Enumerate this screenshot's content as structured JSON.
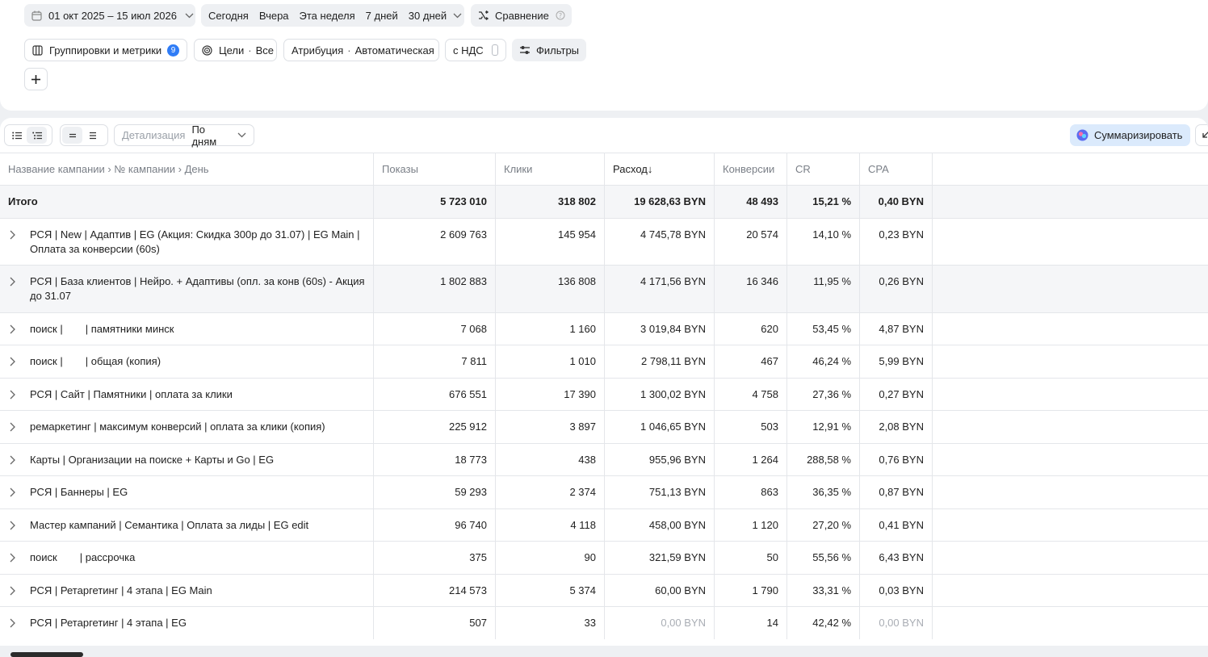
{
  "topbar": {
    "date_range": "01 окт 2025 – 15 июл 2026",
    "quick_ranges": [
      "Сегодня",
      "Вчера",
      "Эта неделя",
      "7 дней",
      "30 дней"
    ],
    "compare_label": "Сравнение",
    "groupings_label": "Группировки и метрики",
    "groupings_count": "9",
    "goals_label": "Цели",
    "goals_value": "Все",
    "attribution_label": "Атрибуция",
    "attribution_value": "Автоматическая",
    "vat_label": "с НДС",
    "filters_label": "Фильтры"
  },
  "toolbar": {
    "detail_label": "Детализация",
    "detail_value": "По дням",
    "summarize_label": "Суммаризировать"
  },
  "colors": {
    "accent": "#2f7cf6",
    "summarize_bg": "#dbeafc"
  },
  "table": {
    "headers": {
      "name": "Название кампании › № кампании › День",
      "shows": "Показы",
      "clicks": "Клики",
      "cost": "Расход",
      "conversions": "Конверсии",
      "cr": "CR",
      "cpa": "CPA"
    },
    "total": {
      "name": "Итого",
      "shows": "5 723 010",
      "clicks": "318 802",
      "cost": "19 628,63 BYN",
      "conversions": "48 493",
      "cr": "15,21 %",
      "cpa": "0,40 BYN"
    },
    "rows": [
      {
        "name": "РСЯ | New | Адаптив | EG (Акция: Скидка 300р до 31.07) | EG Main | Оплата за конверсии (60s)",
        "shows": "2 609 763",
        "clicks": "145 954",
        "cost": "4 745,78 BYN",
        "conversions": "20 574",
        "cr": "14,10 %",
        "cpa": "0,23 BYN"
      },
      {
        "name": "РСЯ | База клиентов | Нейро. + Адаптивы (опл. за конв (60s) - Акция до 31.07",
        "shows": "1 802 883",
        "clicks": "136 808",
        "cost": "4 171,56 BYN",
        "conversions": "16 346",
        "cr": "11,95 %",
        "cpa": "0,26 BYN"
      },
      {
        "name_a": "поиск |",
        "name_b": "| памятники минск",
        "shows": "7 068",
        "clicks": "1 160",
        "cost": "3 019,84 BYN",
        "conversions": "620",
        "cr": "53,45 %",
        "cpa": "4,87 BYN"
      },
      {
        "name_a": "поиск |",
        "name_b": "| общая (копия)",
        "shows": "7 811",
        "clicks": "1 010",
        "cost": "2 798,11 BYN",
        "conversions": "467",
        "cr": "46,24 %",
        "cpa": "5,99 BYN"
      },
      {
        "name": "РСЯ | Сайт | Памятники | оплата за клики",
        "shows": "676 551",
        "clicks": "17 390",
        "cost": "1 300,02 BYN",
        "conversions": "4 758",
        "cr": "27,36 %",
        "cpa": "0,27 BYN"
      },
      {
        "name": "ремаркетинг | максимум конверсий | оплата за клики (копия)",
        "shows": "225 912",
        "clicks": "3 897",
        "cost": "1 046,65 BYN",
        "conversions": "503",
        "cr": "12,91 %",
        "cpa": "2,08 BYN"
      },
      {
        "name": "Карты | Организации на поиске + Карты и Go | EG",
        "shows": "18 773",
        "clicks": "438",
        "cost": "955,96 BYN",
        "conversions": "1 264",
        "cr": "288,58 %",
        "cpa": "0,76 BYN"
      },
      {
        "name": "РСЯ | Баннеры | EG",
        "shows": "59 293",
        "clicks": "2 374",
        "cost": "751,13 BYN",
        "conversions": "863",
        "cr": "36,35 %",
        "cpa": "0,87 BYN"
      },
      {
        "name": "Мастер кампаний | Семантика | Оплата за лиды | EG edit",
        "shows": "96 740",
        "clicks": "4 118",
        "cost": "458,00 BYN",
        "conversions": "1 120",
        "cr": "27,20 %",
        "cpa": "0,41 BYN"
      },
      {
        "name_a": "поиск",
        "name_b": "| рассрочка",
        "shows": "375",
        "clicks": "90",
        "cost": "321,59 BYN",
        "conversions": "50",
        "cr": "55,56 %",
        "cpa": "6,43 BYN"
      },
      {
        "name": "РСЯ | Ретаргетинг | 4 этапа | EG Main",
        "shows": "214 573",
        "clicks": "5 374",
        "cost": "60,00 BYN",
        "conversions": "1 790",
        "cr": "33,31 %",
        "cpa": "0,03 BYN"
      },
      {
        "name": "РСЯ | Ретаргетинг | 4 этапа | EG",
        "shows": "507",
        "clicks": "33",
        "cost": "0,00 BYN",
        "conversions": "14",
        "cr": "42,42 %",
        "cpa": "0,00 BYN"
      }
    ]
  }
}
